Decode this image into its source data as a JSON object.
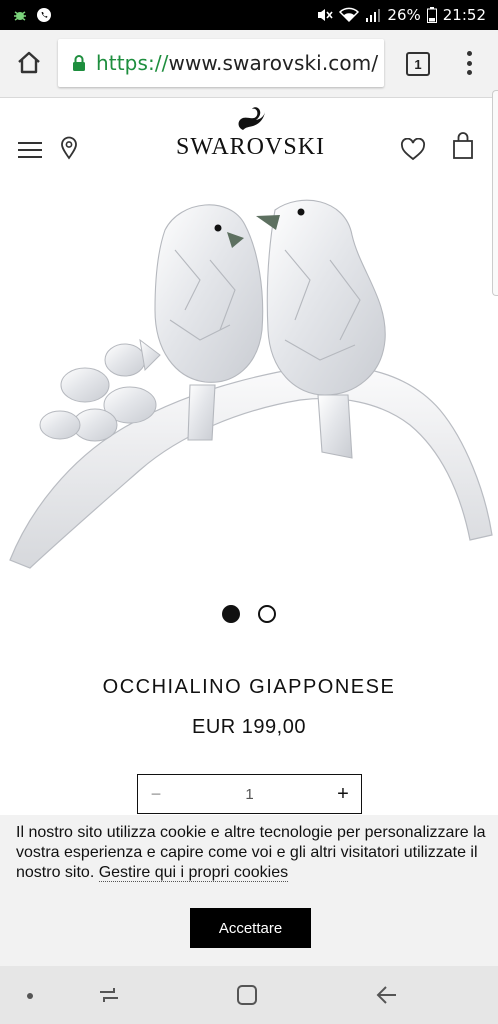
{
  "status_bar": {
    "battery": "26%",
    "time": "21:52"
  },
  "browser": {
    "url_scheme": "https://",
    "url_host": "www.swarovski.com/",
    "tab_count": "1"
  },
  "header": {
    "brand": "SWAROVSKI"
  },
  "carousel": {
    "total": 2,
    "active": 1
  },
  "product": {
    "name": "OCCHIALINO GIAPPONESE",
    "price": "EUR 199,00",
    "quantity": "1",
    "minus": "−",
    "plus": "+"
  },
  "cookie": {
    "text": "Il nostro sito utilizza cookie e altre tecnologie per personalizzare la vostra esperienza e capire come voi e gli altri visitatori utilizzate il nostro sito. ",
    "link": "Gestire qui i propri cookies",
    "accept": "Accettare"
  },
  "colors": {
    "url_secure": "#1e8e3e",
    "button_bg": "#000000",
    "banner_bg": "#f2f2f2"
  },
  "icons": [
    "home-icon",
    "lock-icon",
    "tabs-icon",
    "more-vert-icon",
    "hamburger-icon",
    "location-pin-icon",
    "swan-logo-icon",
    "heart-icon",
    "shopping-bag-icon",
    "recent-apps-icon",
    "android-home-icon",
    "back-icon"
  ]
}
